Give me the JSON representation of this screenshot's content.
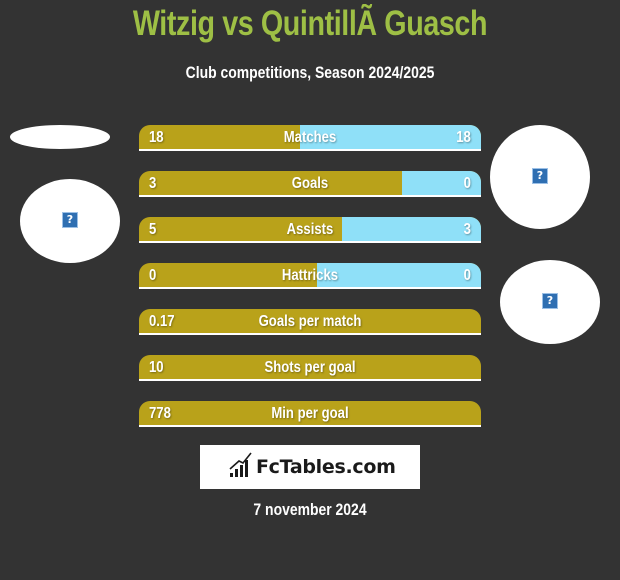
{
  "header": {
    "title": "Witzig vs QuintillÃ  Guasch",
    "subtitle": "Club competitions, Season 2024/2025"
  },
  "colors": {
    "background": "#333333",
    "title": "#9ebf45",
    "left_bar": "#b9a21a",
    "right_bar": "#8fe0f8"
  },
  "stats": [
    {
      "label": "Matches",
      "left": "18",
      "right": "18",
      "right_share": 0.53
    },
    {
      "label": "Goals",
      "left": "3",
      "right": "0",
      "right_share": 0.23
    },
    {
      "label": "Assists",
      "left": "5",
      "right": "3",
      "right_share": 0.405
    },
    {
      "label": "Hattricks",
      "left": "0",
      "right": "0",
      "right_share": 0.48
    },
    {
      "label": "Goals per match",
      "left": "0.17",
      "right": null,
      "right_share": 0
    },
    {
      "label": "Shots per goal",
      "left": "10",
      "right": null,
      "right_share": 0
    },
    {
      "label": "Min per goal",
      "left": "778",
      "right": null,
      "right_share": 0
    }
  ],
  "images": {
    "placeholder_icon": "?",
    "placeholder_icon_name": "broken-image-icon"
  },
  "logo": {
    "text": "FcTables.com",
    "icon": "bar-chart-icon"
  },
  "footer": {
    "date": "7 november 2024"
  }
}
